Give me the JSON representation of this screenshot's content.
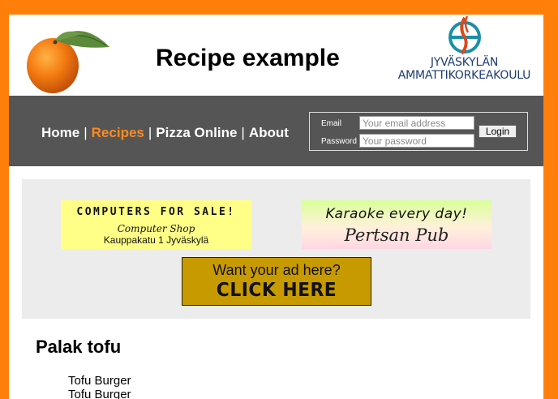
{
  "header": {
    "title": "Recipe example",
    "logo_icon": "orange-fruit-logo",
    "school_logo_icon": "jamk-logo",
    "school_name_line1": "JYVÄSKYLÄN",
    "school_name_line2": "AMMATTIKORKEAKOULU"
  },
  "nav": {
    "items": [
      {
        "label": "Home",
        "active": false
      },
      {
        "label": "Recipes",
        "active": true
      },
      {
        "label": "Pizza Online",
        "active": false
      },
      {
        "label": "About",
        "active": false
      }
    ],
    "separator": "|"
  },
  "login": {
    "email_label": "Email",
    "email_placeholder": "Your email address",
    "password_label": "Password",
    "password_placeholder": "Your password",
    "button_label": "Login"
  },
  "ads": {
    "computer_shop": {
      "headline": "COMPUTERS FOR SALE!",
      "name": "Computer Shop",
      "address": "Kauppakatu 1 Jyväskylä"
    },
    "pub": {
      "headline": "Karaoke every day!",
      "name": "Pertsan Pub"
    },
    "placeholder": {
      "headline": "Want your ad here?",
      "cta": "CLICK HERE"
    }
  },
  "recipe": {
    "title": "Palak tofu",
    "items": [
      "Tofu Burger",
      "Tofu Burger"
    ]
  },
  "colors": {
    "frame": "#ff7f0a",
    "navbar": "#555555",
    "active_nav": "#ff8a1f",
    "ad_panel": "#ececec"
  }
}
